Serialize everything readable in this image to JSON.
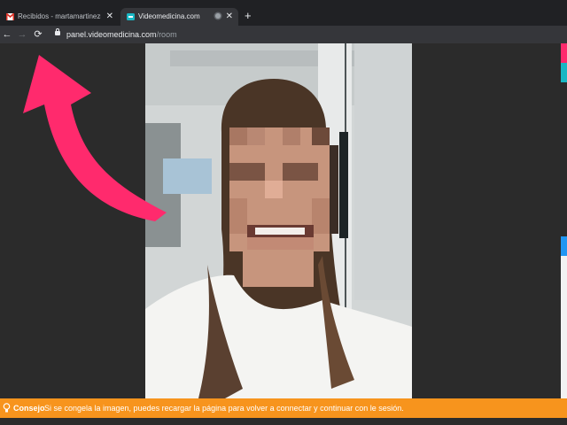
{
  "browser": {
    "tabs": [
      {
        "title": "Recibidos - martamartinezmartinez",
        "favicon": "gmail-icon",
        "active": false
      },
      {
        "title": "Videomedicina.com",
        "favicon": "videomedicina-icon",
        "active": true
      }
    ],
    "url_domain": "panel.videomedicina.com",
    "url_path": "/room"
  },
  "annotation": {
    "icon": "curved-arrow-icon",
    "color": "#ff2a6d"
  },
  "tip": {
    "label": "Consejo",
    "message": "Si se congela la imagen, puedes recargar la página para volver a connectar y continuar con le sesión.",
    "background": "#f7941d"
  }
}
